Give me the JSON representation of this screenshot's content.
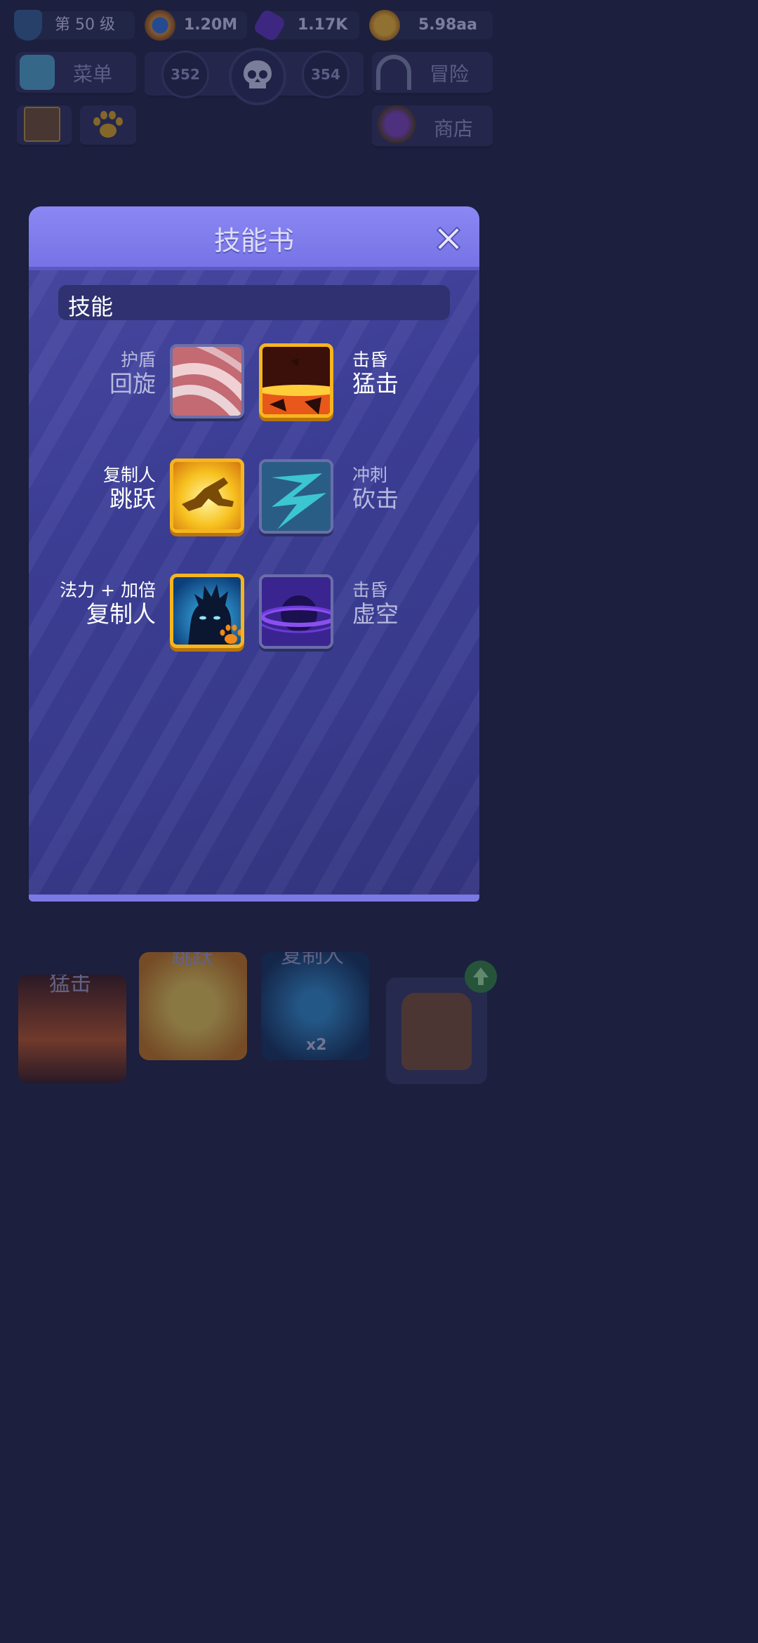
{
  "colors": {
    "accent": "#7b79e4",
    "gold": "#f6b51d",
    "panel": "#3d3f98",
    "bg": "#1c1f3d"
  },
  "topbar": {
    "level": {
      "icon": "shield-icon",
      "label": "第 50 级"
    },
    "orbs": {
      "icon": "orb-icon",
      "value": "1.20M"
    },
    "gems": {
      "icon": "gem-icon",
      "value": "1.17K"
    },
    "coins": {
      "icon": "coin-icon",
      "value": "5.98aa"
    }
  },
  "nav": {
    "menu_label": "菜单",
    "stage_prev": "352",
    "stage_next": "354",
    "adventure_label": "冒险",
    "shop_label": "商店"
  },
  "dialog": {
    "title": "技能书",
    "section_label": "技能",
    "rows": [
      {
        "left": {
          "small": "护盾",
          "big": "回旋",
          "icon": "spin-slash-icon",
          "selected": false
        },
        "right": {
          "small": "击昏",
          "big": "猛击",
          "icon": "smash-icon",
          "selected": true
        }
      },
      {
        "left": {
          "small": "复制人",
          "big": "跳跃",
          "icon": "leap-icon",
          "selected": true
        },
        "right": {
          "small": "冲刺",
          "big": "砍击",
          "icon": "dash-slash-icon",
          "selected": false
        }
      },
      {
        "left": {
          "small": "法力 + 加倍",
          "big": "复制人",
          "icon": "clone-icon",
          "selected": true
        },
        "right": {
          "small": "击昏",
          "big": "虚空",
          "icon": "void-icon",
          "selected": false
        }
      }
    ]
  },
  "skillbar": {
    "slot1": "猛击",
    "slot2": "跳跃",
    "slot3": "复制人",
    "slot3_badge": "x2"
  }
}
